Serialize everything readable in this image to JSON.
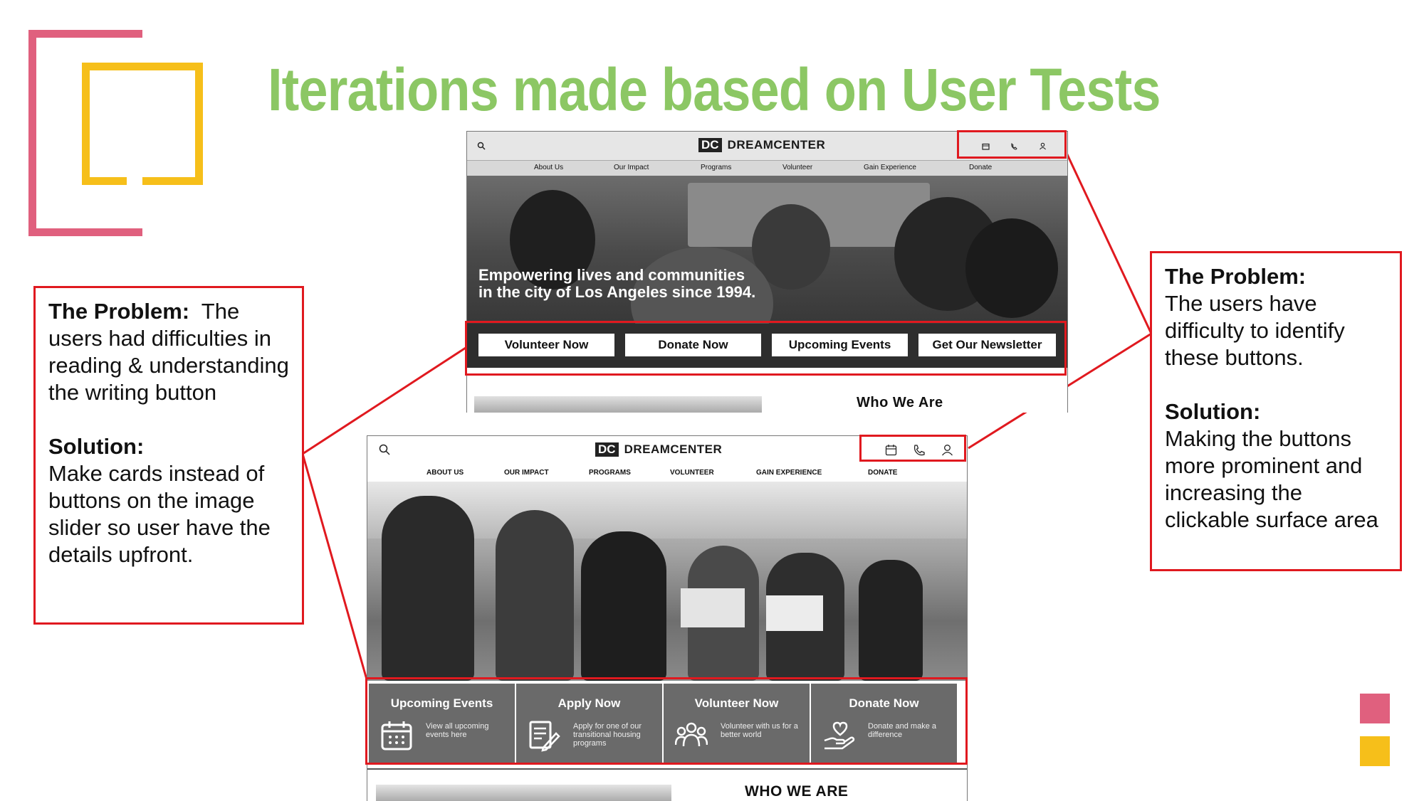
{
  "title": "Iterations made based on User Tests",
  "left_callout": {
    "problem_label": "The Problem:",
    "problem_text": "The users had difficulties in reading & understanding  the writing button",
    "solution_label": "Solution:",
    "solution_text": "Make cards instead of buttons on the image slider so user have the details upfront."
  },
  "right_callout": {
    "problem_label": "The Problem:",
    "problem_text": "The users have difficulty to identify these buttons.",
    "solution_label": "Solution:",
    "solution_text": "Making the buttons more prominent and increasing the clickable surface area"
  },
  "old_design": {
    "brand_logo": "DC",
    "brand": "DREAMCENTER",
    "nav": [
      "About Us",
      "Our Impact",
      "Programs",
      "Volunteer",
      "Gain Experience",
      "Donate"
    ],
    "hero_text_line1": "Empowering lives and communities",
    "hero_text_line2": "in the city of Los Angeles since 1994.",
    "buttons": [
      "Volunteer Now",
      "Donate Now",
      "Upcoming Events",
      "Get Our Newsletter"
    ],
    "section_heading": "Who We Are"
  },
  "new_design": {
    "brand_logo": "DC",
    "brand": "DREAMCENTER",
    "nav": [
      "ABOUT US",
      "OUR IMPACT",
      "PROGRAMS",
      "VOLUNTEER",
      "GAIN EXPERIENCE",
      "DONATE"
    ],
    "cards": [
      {
        "title": "Upcoming Events",
        "desc": "View all upcoming events here",
        "icon": "calendar-icon"
      },
      {
        "title": "Apply Now",
        "desc": "Apply for one of our transitional housing programs",
        "icon": "form-icon"
      },
      {
        "title": "Volunteer Now",
        "desc": "Volunteer with us for a better world",
        "icon": "people-icon"
      },
      {
        "title": "Donate Now",
        "desc": "Donate and make a difference",
        "icon": "heart-hand-icon"
      }
    ],
    "section_heading": "WHO WE ARE"
  },
  "colors": {
    "title_green": "#8cc764",
    "accent_red": "#e0191f",
    "brand_pink": "#e0607e",
    "brand_yellow": "#f6bf1a"
  }
}
